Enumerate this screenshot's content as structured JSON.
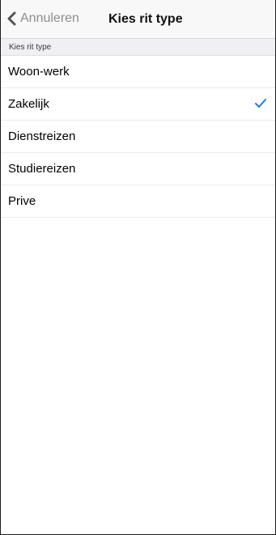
{
  "navbar": {
    "back_label": "Annuleren",
    "title": "Kies rit type"
  },
  "section": {
    "header": "Kies rit type"
  },
  "items": [
    {
      "label": "Woon-werk",
      "selected": false
    },
    {
      "label": "Zakelijk",
      "selected": true
    },
    {
      "label": "Dienstreizen",
      "selected": false
    },
    {
      "label": "Studiereizen",
      "selected": false
    },
    {
      "label": "Prive",
      "selected": false
    }
  ],
  "icons": {
    "back": "chevron-left-icon",
    "selected": "checkmark-icon"
  },
  "colors": {
    "accent": "#1a7cf5",
    "back_text": "#8e8e93",
    "section_background": "#efeff4"
  }
}
